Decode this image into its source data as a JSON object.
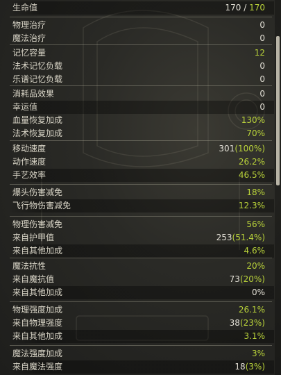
{
  "groups": [
    {
      "rows": [
        {
          "label": "生命值",
          "value_a": "170 / ",
          "value_b": "170"
        }
      ]
    },
    {
      "rows": [
        {
          "label": "物理治疗",
          "value": "0"
        },
        {
          "label": "魔法治疗",
          "value": "0"
        }
      ]
    },
    {
      "rows": [
        {
          "label": "记忆容量",
          "value": "12"
        },
        {
          "label": "法术记忆负载",
          "value": "0"
        },
        {
          "label": "乐谱记忆负载",
          "value": "0"
        }
      ]
    },
    {
      "rows": [
        {
          "label": "消耗品效果",
          "value": "0"
        },
        {
          "label": "幸运值",
          "value": "0"
        },
        {
          "label": "血量恢复加成",
          "value": "130%"
        },
        {
          "label": "法术恢复加成",
          "value": "70%"
        }
      ]
    },
    {
      "rows": [
        {
          "label": "移动速度",
          "value_a": "301",
          "value_b": "(100%)"
        },
        {
          "label": "动作速度",
          "value": "26.2%"
        },
        {
          "label": "手艺效率",
          "value": "46.5%"
        }
      ]
    },
    {
      "rows": [
        {
          "label": "爆头伤害减免",
          "value": "18%"
        },
        {
          "label": "飞行物伤害减免",
          "value": "12.3%"
        }
      ]
    },
    {
      "rows": [
        {
          "label": "物理伤害减免",
          "value": "56%"
        },
        {
          "label": "来自护甲值",
          "value_a": "253",
          "value_b": "(51.4%)"
        },
        {
          "label": "来自其他加成",
          "value": "4.6%"
        }
      ]
    },
    {
      "rows": [
        {
          "label": "魔法抗性",
          "value": "20%"
        },
        {
          "label": "来自魔抗值",
          "value_a": "73",
          "value_b": "(20%)"
        },
        {
          "label": "来自其他加成",
          "value": "0%"
        }
      ]
    },
    {
      "rows": [
        {
          "label": "物理强度加成",
          "value": "26.1%"
        },
        {
          "label": "来自物理强度",
          "value_a": "38",
          "value_b": "(23%)"
        },
        {
          "label": "来自其他加成",
          "value": "3.1%"
        }
      ]
    },
    {
      "rows": [
        {
          "label": "魔法强度加成",
          "value": "3%"
        },
        {
          "label": "来自魔法强度",
          "value_a": "18",
          "value_b": "(3%)"
        }
      ]
    }
  ],
  "colors": {
    "white": "#e3e0d6",
    "green": "#b9d23a"
  },
  "icons": {
    "decor": "ornament-icon"
  }
}
